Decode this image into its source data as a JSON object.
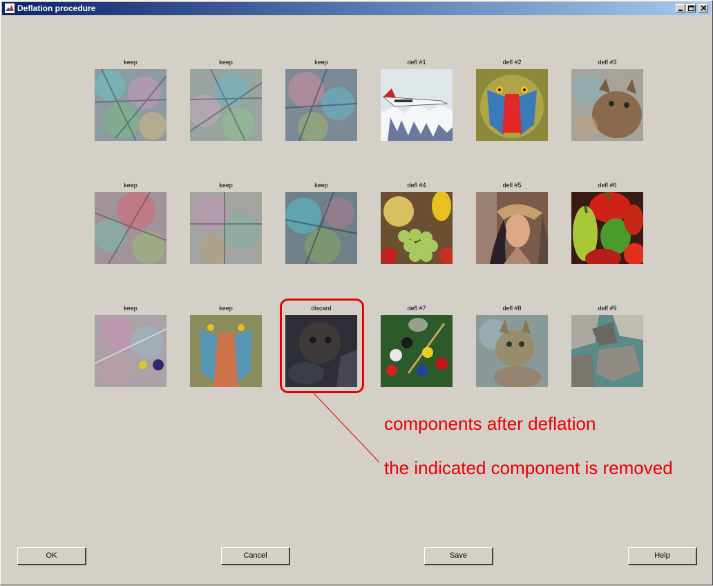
{
  "window": {
    "title": "Deflation procedure"
  },
  "tiles": [
    {
      "label": "keep",
      "icon": "mixed-component-image"
    },
    {
      "label": "keep",
      "icon": "mixed-component-image"
    },
    {
      "label": "keep",
      "icon": "mixed-component-image"
    },
    {
      "label": "defl #1",
      "icon": "airplane-image"
    },
    {
      "label": "defl #2",
      "icon": "mandrill-image"
    },
    {
      "label": "defl #3",
      "icon": "cat-image"
    },
    {
      "label": "keep",
      "icon": "mixed-component-image"
    },
    {
      "label": "keep",
      "icon": "mixed-component-image"
    },
    {
      "label": "keep",
      "icon": "mixed-component-image"
    },
    {
      "label": "defl #4",
      "icon": "fruits-image"
    },
    {
      "label": "defl #5",
      "icon": "portrait-image"
    },
    {
      "label": "defl #6",
      "icon": "peppers-image"
    },
    {
      "label": "keep",
      "icon": "mixed-component-image"
    },
    {
      "label": "keep",
      "icon": "mixed-component-image"
    },
    {
      "label": "discard",
      "icon": "dark-component-image"
    },
    {
      "label": "defl #7",
      "icon": "billiards-image"
    },
    {
      "label": "defl #8",
      "icon": "mixed-cat-image"
    },
    {
      "label": "defl #9",
      "icon": "rocks-image"
    }
  ],
  "annotations": {
    "line1": "components after deflation",
    "line2": "the indicated component is removed",
    "color": "#e60000"
  },
  "buttons": {
    "ok": "OK",
    "cancel": "Cancel",
    "save": "Save",
    "help": "Help"
  }
}
